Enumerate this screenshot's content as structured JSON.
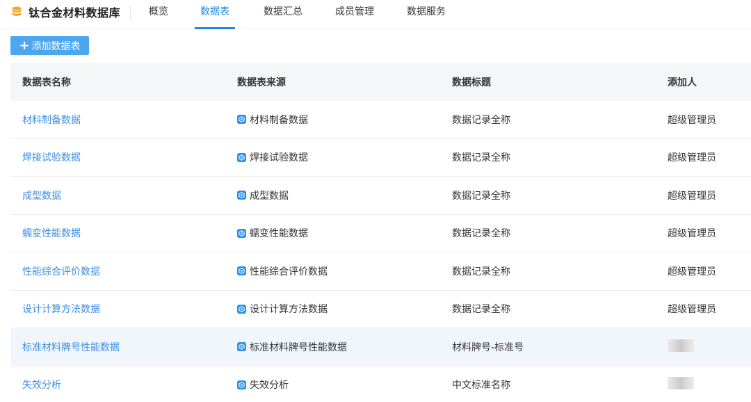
{
  "app": {
    "title": "钛合金材料数据库",
    "logo_icon": "database-icon",
    "accent": "#1e88e5"
  },
  "nav": [
    {
      "label": "概览",
      "active": false
    },
    {
      "label": "数据表",
      "active": true
    },
    {
      "label": "数据汇总",
      "active": false
    },
    {
      "label": "成员管理",
      "active": false
    },
    {
      "label": "数据服务",
      "active": false
    }
  ],
  "toolbar": {
    "add_label": "添加数据表",
    "add_icon": "plus-icon"
  },
  "table": {
    "columns": [
      "数据表名称",
      "数据表来源",
      "数据标题",
      "添加人"
    ],
    "rows": [
      {
        "name": "材料制备数据",
        "source": "材料制备数据",
        "title": "数据记录全称",
        "adder": "超级管理员"
      },
      {
        "name": "焊接试验数据",
        "source": "焊接试验数据",
        "title": "数据记录全称",
        "adder": "超级管理员"
      },
      {
        "name": "成型数据",
        "source": "成型数据",
        "title": "数据记录全称",
        "adder": "超级管理员"
      },
      {
        "name": "蠕变性能数据",
        "source": "蠕变性能数据",
        "title": "数据记录全称",
        "adder": "超级管理员"
      },
      {
        "name": "性能综合评价数据",
        "source": "性能综合评价数据",
        "title": "数据记录全称",
        "adder": "超级管理员"
      },
      {
        "name": "设计计算方法数据",
        "source": "设计计算方法数据",
        "title": "数据记录全称",
        "adder": "超级管理员"
      },
      {
        "name": "标准材料牌号性能数据",
        "source": "标准材料牌号性能数据",
        "title": "材料牌号-标准号",
        "adder": "",
        "adder_blurred": true,
        "highlight": true
      },
      {
        "name": "失效分析",
        "source": "失效分析",
        "title": "中文标准名称",
        "adder": "",
        "adder_blurred": true
      }
    ]
  }
}
